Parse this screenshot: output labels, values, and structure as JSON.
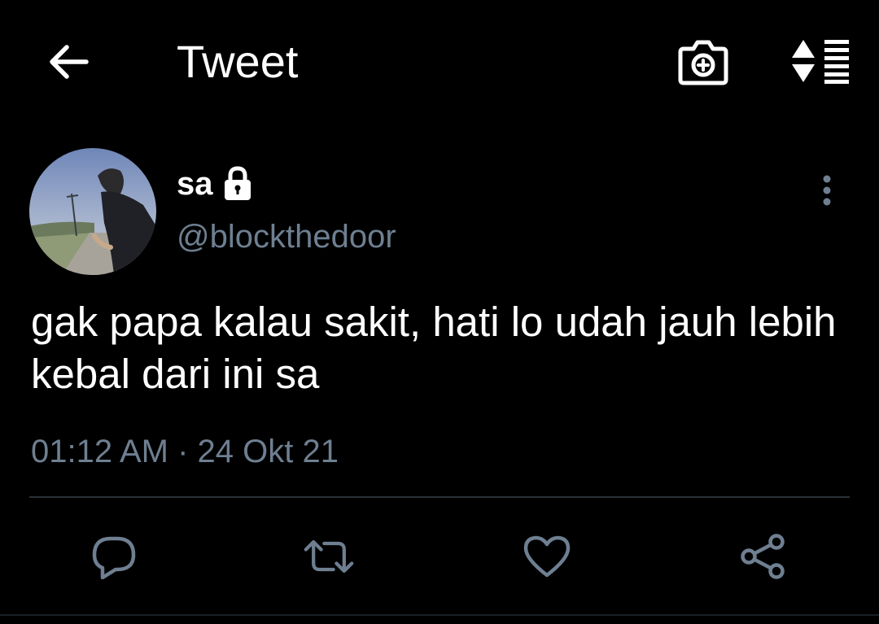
{
  "header": {
    "title": "Tweet",
    "back_icon": "arrow-left-icon",
    "camera_icon": "camera-add-icon",
    "sort_icon": "sort-list-icon"
  },
  "author": {
    "display_name": "sa",
    "handle": "@blockthedoor",
    "protected_icon": "lock-icon",
    "avatar_icon": "avatar-photo"
  },
  "tweet": {
    "text": "gak papa kalau sakit, hati lo udah jauh lebih kebal dari ini sa",
    "timestamp": "01:12 AM · 24 Okt 21"
  },
  "actions": {
    "reply_icon": "reply-icon",
    "retweet_icon": "retweet-icon",
    "like_icon": "heart-icon",
    "share_icon": "share-icon"
  },
  "colors": {
    "background": "#000000",
    "text": "#ffffff",
    "muted": "#6e7f91",
    "divider": "#2a3239"
  }
}
